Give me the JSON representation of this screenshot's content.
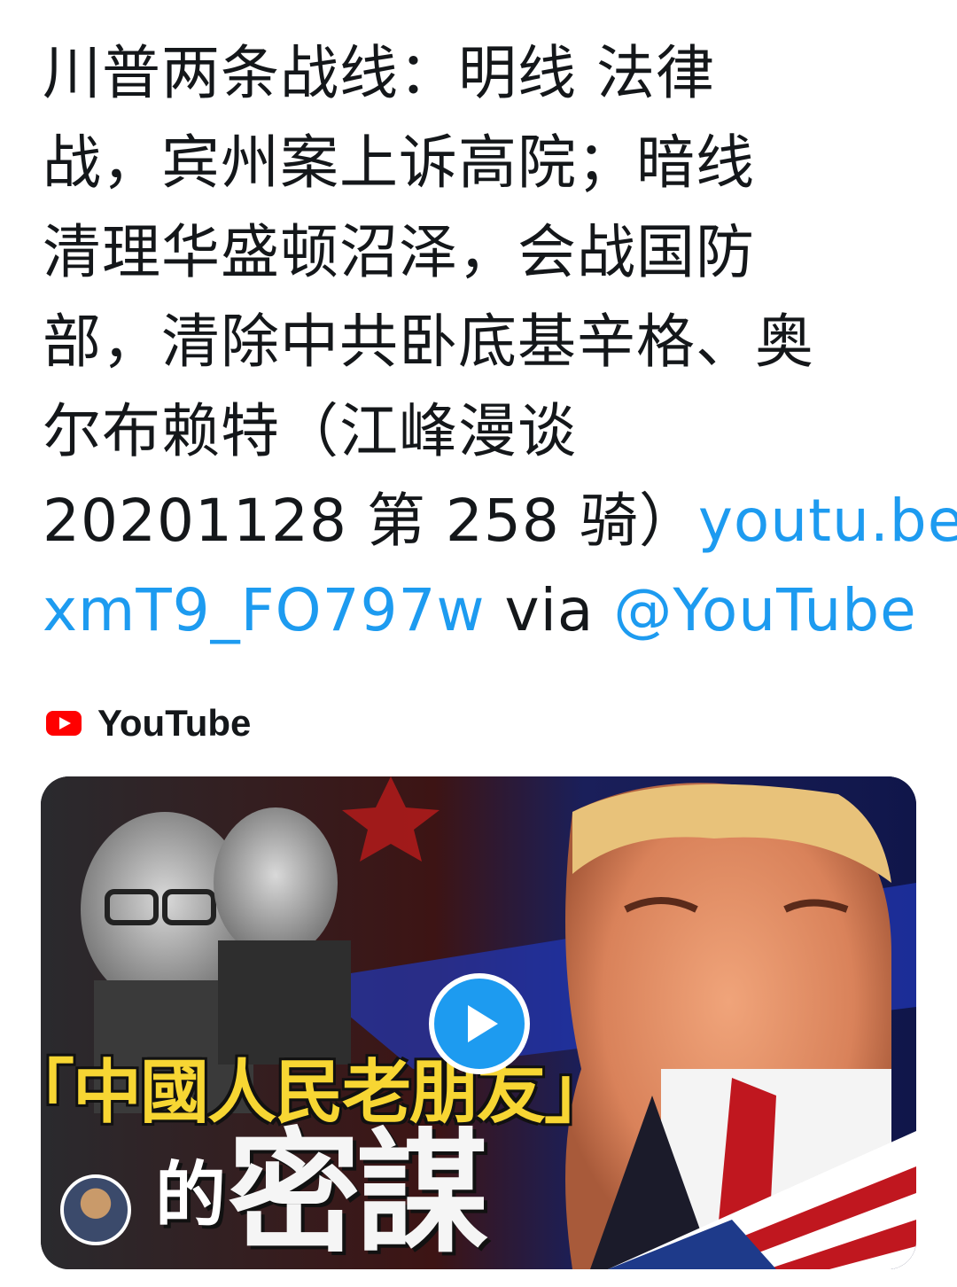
{
  "tweet": {
    "lines": [
      "川普两条战线：明线  法律",
      "战，宾州案上诉高院；暗线",
      "清理华盛顿沼泽，会战国防",
      "部，清除中共卧底基辛格、奥",
      "尔布赖特（江峰漫谈",
      "20201128 第 258 骑）"
    ],
    "link_part1": "youtu.be/",
    "link_part2": "xmT9_FO797w",
    "via_text": " via ",
    "mention": "@YouTube"
  },
  "card": {
    "source_name": "YouTube",
    "source_icon": "youtube-logo-icon",
    "thumbnail_headline": "「中國人民老朋友」",
    "thumbnail_small": "的",
    "thumbnail_big": "密謀",
    "play_icon": "play-icon"
  },
  "colors": {
    "link": "#1d9bf0",
    "text": "#14171a",
    "youtube_red": "#ff0000",
    "headline_yellow": "#f7d633"
  }
}
